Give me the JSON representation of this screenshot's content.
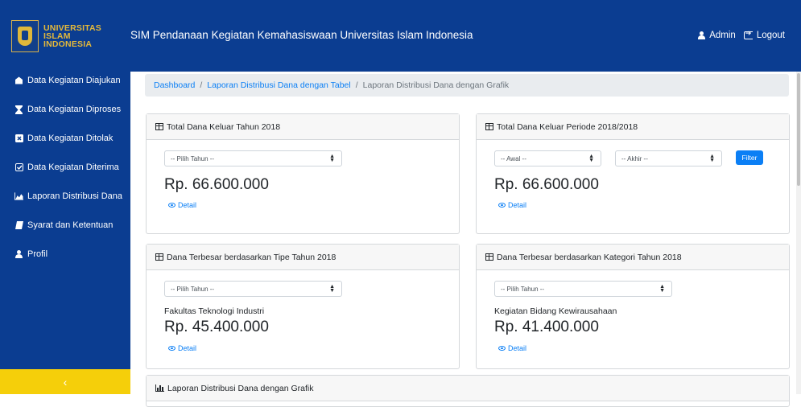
{
  "header": {
    "logo_line1": "UNIVERSITAS",
    "logo_line2": "ISLAM",
    "logo_line3": "INDONESIA",
    "title": "SIM Pendanaan Kegiatan Kemahasiswaan Universitas Islam Indonesia",
    "user_label": "Admin",
    "logout_label": "Logout"
  },
  "sidebar": {
    "items": [
      {
        "label": "Data Kegiatan Diajukan",
        "icon": "inbox-icon"
      },
      {
        "label": "Data Kegiatan Diproses",
        "icon": "hourglass-icon"
      },
      {
        "label": "Data Kegiatan Ditolak",
        "icon": "close-box-icon"
      },
      {
        "label": "Data Kegiatan Diterima",
        "icon": "check-square-icon"
      },
      {
        "label": "Laporan Distribusi Dana",
        "icon": "area-chart-icon"
      },
      {
        "label": "Syarat dan Ketentuan",
        "icon": "book-icon"
      },
      {
        "label": "Profil",
        "icon": "user-icon"
      }
    ],
    "toggle_label": "‹"
  },
  "breadcrumb": {
    "items": [
      "Dashboard",
      "Laporan Distribusi Dana dengan Tabel"
    ],
    "current": "Laporan Distribusi Dana dengan Grafik",
    "separator": "/"
  },
  "cards": {
    "total_year": {
      "title": "Total Dana Keluar Tahun 2018",
      "select": "-- Pilih Tahun --",
      "amount": "Rp. 66.600.000",
      "detail": "Detail"
    },
    "total_period": {
      "title": "Total Dana Keluar Periode 2018/2018",
      "select_start": "-- Awal --",
      "select_end": "-- Akhir --",
      "filter": "Filter",
      "amount": "Rp. 66.600.000",
      "detail": "Detail"
    },
    "by_type": {
      "title": "Dana Terbesar berdasarkan Tipe Tahun 2018",
      "select": "-- Pilih Tahun --",
      "name": "Fakultas Teknologi Industri",
      "amount": "Rp. 45.400.000",
      "detail": "Detail"
    },
    "by_category": {
      "title": "Dana Terbesar berdasarkan Kategori Tahun 2018",
      "select": "-- Pilih Tahun --",
      "name": "Kegiatan Bidang Kewirausahaan",
      "amount": "Rp. 41.400.000",
      "detail": "Detail"
    },
    "chart": {
      "title": "Laporan Distribusi Dana dengan Grafik"
    }
  },
  "colors": {
    "primary": "#0b3d91",
    "accent": "#f5cf0a",
    "link": "#0b7ff5"
  }
}
